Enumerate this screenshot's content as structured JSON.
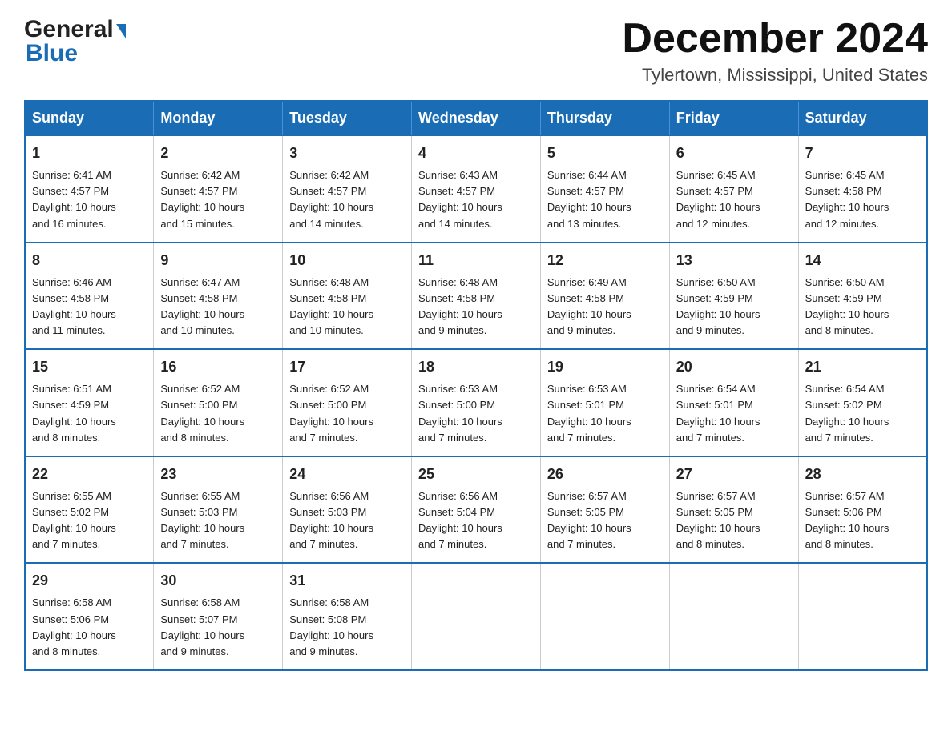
{
  "header": {
    "logo": {
      "general": "General",
      "blue": "Blue"
    },
    "title": "December 2024",
    "location": "Tylertown, Mississippi, United States"
  },
  "calendar": {
    "days_of_week": [
      "Sunday",
      "Monday",
      "Tuesday",
      "Wednesday",
      "Thursday",
      "Friday",
      "Saturday"
    ],
    "weeks": [
      [
        {
          "day": "1",
          "sunrise": "6:41 AM",
          "sunset": "4:57 PM",
          "daylight": "10 hours and 16 minutes."
        },
        {
          "day": "2",
          "sunrise": "6:42 AM",
          "sunset": "4:57 PM",
          "daylight": "10 hours and 15 minutes."
        },
        {
          "day": "3",
          "sunrise": "6:42 AM",
          "sunset": "4:57 PM",
          "daylight": "10 hours and 14 minutes."
        },
        {
          "day": "4",
          "sunrise": "6:43 AM",
          "sunset": "4:57 PM",
          "daylight": "10 hours and 14 minutes."
        },
        {
          "day": "5",
          "sunrise": "6:44 AM",
          "sunset": "4:57 PM",
          "daylight": "10 hours and 13 minutes."
        },
        {
          "day": "6",
          "sunrise": "6:45 AM",
          "sunset": "4:57 PM",
          "daylight": "10 hours and 12 minutes."
        },
        {
          "day": "7",
          "sunrise": "6:45 AM",
          "sunset": "4:58 PM",
          "daylight": "10 hours and 12 minutes."
        }
      ],
      [
        {
          "day": "8",
          "sunrise": "6:46 AM",
          "sunset": "4:58 PM",
          "daylight": "10 hours and 11 minutes."
        },
        {
          "day": "9",
          "sunrise": "6:47 AM",
          "sunset": "4:58 PM",
          "daylight": "10 hours and 10 minutes."
        },
        {
          "day": "10",
          "sunrise": "6:48 AM",
          "sunset": "4:58 PM",
          "daylight": "10 hours and 10 minutes."
        },
        {
          "day": "11",
          "sunrise": "6:48 AM",
          "sunset": "4:58 PM",
          "daylight": "10 hours and 9 minutes."
        },
        {
          "day": "12",
          "sunrise": "6:49 AM",
          "sunset": "4:58 PM",
          "daylight": "10 hours and 9 minutes."
        },
        {
          "day": "13",
          "sunrise": "6:50 AM",
          "sunset": "4:59 PM",
          "daylight": "10 hours and 9 minutes."
        },
        {
          "day": "14",
          "sunrise": "6:50 AM",
          "sunset": "4:59 PM",
          "daylight": "10 hours and 8 minutes."
        }
      ],
      [
        {
          "day": "15",
          "sunrise": "6:51 AM",
          "sunset": "4:59 PM",
          "daylight": "10 hours and 8 minutes."
        },
        {
          "day": "16",
          "sunrise": "6:52 AM",
          "sunset": "5:00 PM",
          "daylight": "10 hours and 8 minutes."
        },
        {
          "day": "17",
          "sunrise": "6:52 AM",
          "sunset": "5:00 PM",
          "daylight": "10 hours and 7 minutes."
        },
        {
          "day": "18",
          "sunrise": "6:53 AM",
          "sunset": "5:00 PM",
          "daylight": "10 hours and 7 minutes."
        },
        {
          "day": "19",
          "sunrise": "6:53 AM",
          "sunset": "5:01 PM",
          "daylight": "10 hours and 7 minutes."
        },
        {
          "day": "20",
          "sunrise": "6:54 AM",
          "sunset": "5:01 PM",
          "daylight": "10 hours and 7 minutes."
        },
        {
          "day": "21",
          "sunrise": "6:54 AM",
          "sunset": "5:02 PM",
          "daylight": "10 hours and 7 minutes."
        }
      ],
      [
        {
          "day": "22",
          "sunrise": "6:55 AM",
          "sunset": "5:02 PM",
          "daylight": "10 hours and 7 minutes."
        },
        {
          "day": "23",
          "sunrise": "6:55 AM",
          "sunset": "5:03 PM",
          "daylight": "10 hours and 7 minutes."
        },
        {
          "day": "24",
          "sunrise": "6:56 AM",
          "sunset": "5:03 PM",
          "daylight": "10 hours and 7 minutes."
        },
        {
          "day": "25",
          "sunrise": "6:56 AM",
          "sunset": "5:04 PM",
          "daylight": "10 hours and 7 minutes."
        },
        {
          "day": "26",
          "sunrise": "6:57 AM",
          "sunset": "5:05 PM",
          "daylight": "10 hours and 7 minutes."
        },
        {
          "day": "27",
          "sunrise": "6:57 AM",
          "sunset": "5:05 PM",
          "daylight": "10 hours and 8 minutes."
        },
        {
          "day": "28",
          "sunrise": "6:57 AM",
          "sunset": "5:06 PM",
          "daylight": "10 hours and 8 minutes."
        }
      ],
      [
        {
          "day": "29",
          "sunrise": "6:58 AM",
          "sunset": "5:06 PM",
          "daylight": "10 hours and 8 minutes."
        },
        {
          "day": "30",
          "sunrise": "6:58 AM",
          "sunset": "5:07 PM",
          "daylight": "10 hours and 9 minutes."
        },
        {
          "day": "31",
          "sunrise": "6:58 AM",
          "sunset": "5:08 PM",
          "daylight": "10 hours and 9 minutes."
        },
        null,
        null,
        null,
        null
      ]
    ],
    "labels": {
      "sunrise": "Sunrise:",
      "sunset": "Sunset:",
      "daylight": "Daylight:"
    }
  }
}
